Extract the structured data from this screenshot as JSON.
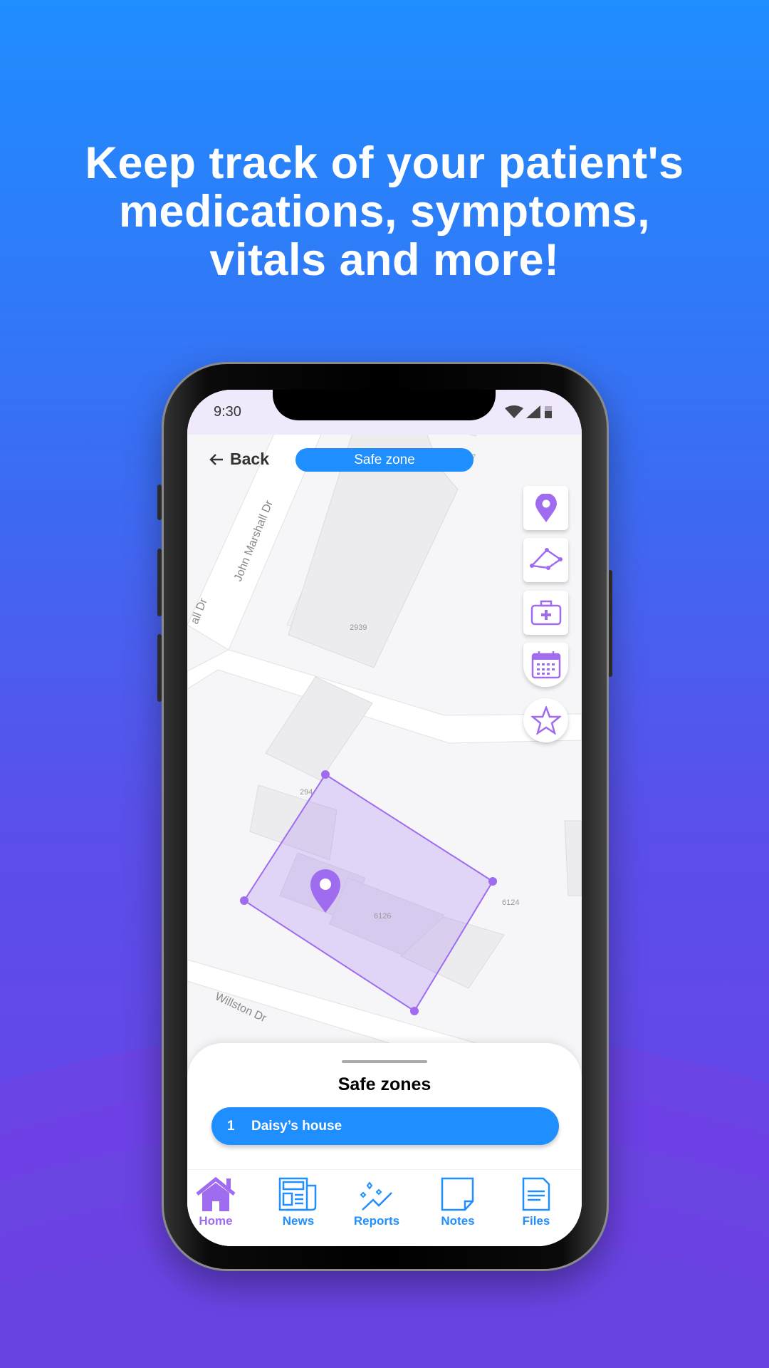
{
  "headline": [
    "Keep track of your patient's",
    "medications, symptoms,",
    "vitals and more!"
  ],
  "status": {
    "time": "9:30",
    "icons": [
      "wifi-icon",
      "signal-icon",
      "battery-icon"
    ]
  },
  "header": {
    "back_label": "Back",
    "title": "Safe zone"
  },
  "map": {
    "streets": [
      "John Marshall Dr",
      "all Dr",
      "Willston Dr"
    ],
    "buildings": [
      "2939",
      "37",
      "294",
      "6126",
      "6124"
    ]
  },
  "tools": [
    "location-pin-icon",
    "polygon-icon",
    "medical-kit-icon",
    "calendar-icon",
    "star-icon"
  ],
  "sheet": {
    "title": "Safe zones",
    "zones": [
      {
        "index": "1",
        "name": "Daisy’s house"
      }
    ]
  },
  "nav": [
    {
      "label": "Home",
      "icon": "home-icon",
      "active": true
    },
    {
      "label": "News",
      "icon": "newspaper-icon"
    },
    {
      "label": "Reports",
      "icon": "reports-icon"
    },
    {
      "label": "Notes",
      "icon": "note-icon"
    },
    {
      "label": "Files",
      "icon": "file-icon"
    }
  ],
  "colors": {
    "accent_blue": "#1f8efe",
    "accent_purple": "#9f6cf0",
    "status_bar": "#efe9fb"
  }
}
